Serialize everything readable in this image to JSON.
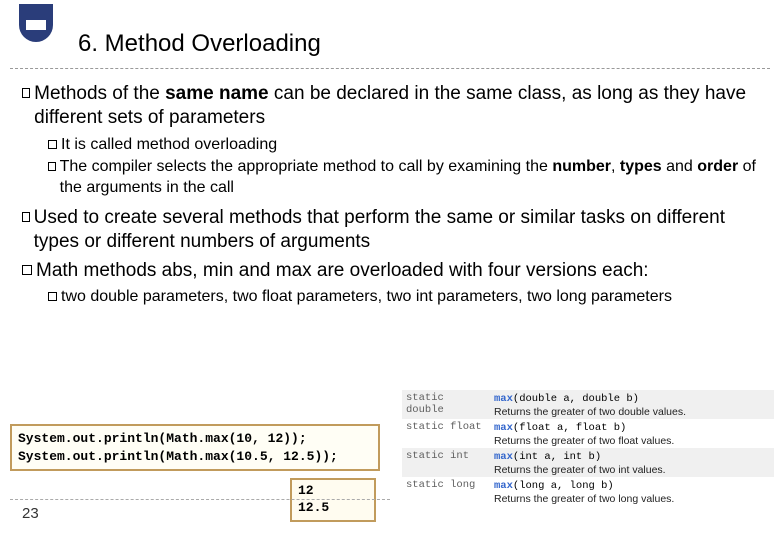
{
  "title": "6. Method Overloading",
  "bullets": {
    "b1_prefix": "Methods of the ",
    "b1_bold1": "same name",
    "b1_mid": " can be declared in the same class, as long as they have different sets of parameters",
    "b1_sub1": "It is called method overloading",
    "b1_sub2_prefix": "The compiler selects the appropriate method to call by examining the ",
    "b1_sub2_b1": "number",
    "b1_sub2_m1": ", ",
    "b1_sub2_b2": "types",
    "b1_sub2_m2": " and ",
    "b1_sub2_b3": "order",
    "b1_sub2_suffix": " of the arguments in the call",
    "b2": "Used to create several methods that perform the same or similar tasks on different types or different numbers of arguments",
    "b3": "Math methods abs, min and max are overloaded with four versions each:",
    "b3_sub1": "two double parameters, two float parameters, two int parameters, two long parameters"
  },
  "code": {
    "line1": "System.out.println(Math.max(10, 12));",
    "line2": "System.out.println(Math.max(10.5, 12.5));"
  },
  "output": {
    "line1": "12",
    "line2": "12.5"
  },
  "api": [
    {
      "mod": "static double",
      "method": "max",
      "params": "(double a, double b)",
      "desc": "Returns the greater of two double values."
    },
    {
      "mod": "static float",
      "method": "max",
      "params": "(float a, float b)",
      "desc": "Returns the greater of two float values."
    },
    {
      "mod": "static int",
      "method": "max",
      "params": "(int a, int b)",
      "desc": "Returns the greater of two int values."
    },
    {
      "mod": "static long",
      "method": "max",
      "params": "(long a, long b)",
      "desc": "Returns the greater of two long values."
    }
  ],
  "pageNum": "23"
}
